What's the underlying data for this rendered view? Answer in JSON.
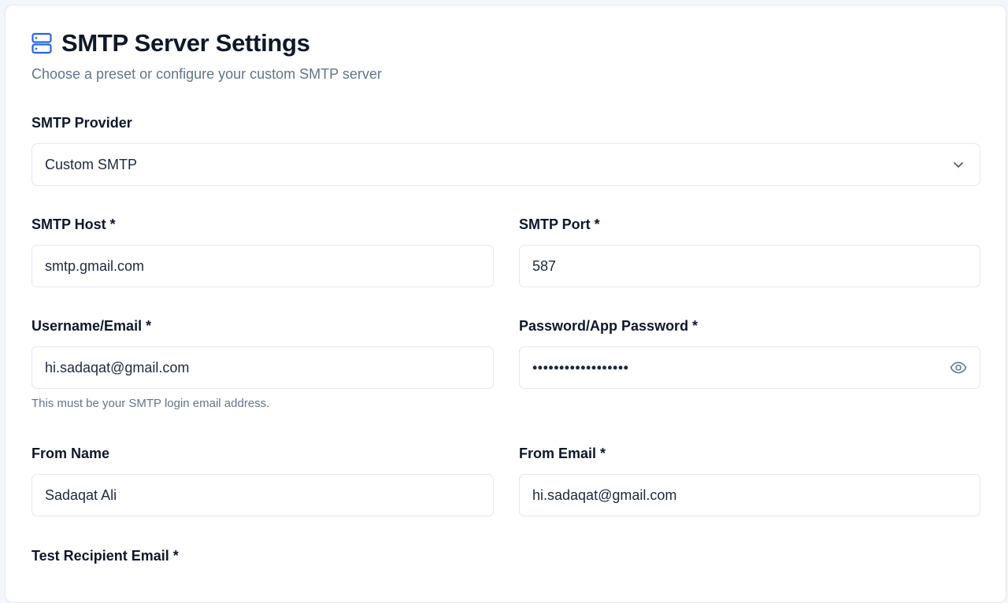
{
  "header": {
    "icon": "server-icon",
    "title": "SMTP Server Settings",
    "subtitle": "Choose a preset or configure your custom SMTP server"
  },
  "provider": {
    "label": "SMTP Provider",
    "selected": "Custom SMTP",
    "dropdown_icon": "chevron-down-icon"
  },
  "host": {
    "label": "SMTP Host *",
    "value": "smtp.gmail.com"
  },
  "port": {
    "label": "SMTP Port *",
    "value": "587"
  },
  "username": {
    "label": "Username/Email *",
    "value": "hi.sadaqat@gmail.com",
    "hint": "This must be your SMTP login email address."
  },
  "password": {
    "label": "Password/App Password *",
    "value": "••••••••••••••••••",
    "toggle_icon": "eye-icon"
  },
  "from_name": {
    "label": "From Name",
    "value": "Sadaqat Ali"
  },
  "from_email": {
    "label": "From Email *",
    "value": "hi.sadaqat@gmail.com"
  },
  "test_recipient": {
    "label": "Test Recipient Email *"
  },
  "colors": {
    "accent": "#2563eb",
    "text": "#0f172a",
    "muted": "#64748b",
    "border": "#e2e8f0"
  }
}
